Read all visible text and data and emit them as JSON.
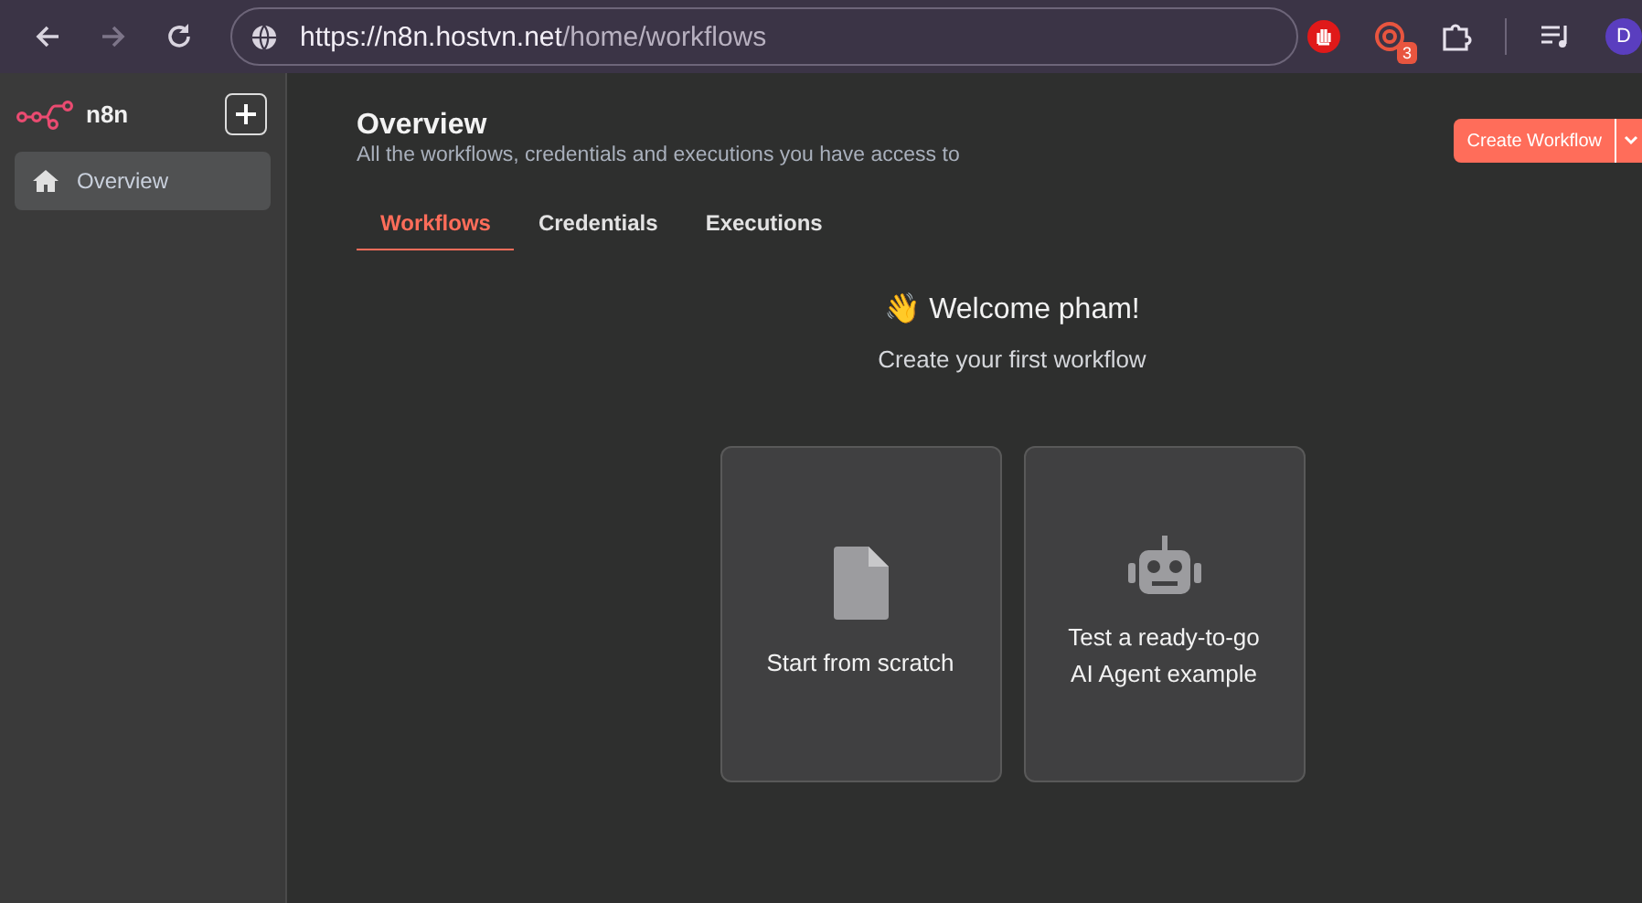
{
  "browser": {
    "url_host": "https://n8n.hostvn.net",
    "url_path": "/home/workflows",
    "extension_badge": "3",
    "avatar": "D"
  },
  "sidebar": {
    "logo": "n8n",
    "items": [
      {
        "label": "Overview",
        "selected": true
      }
    ]
  },
  "header": {
    "title": "Overview",
    "subtitle": "All the workflows, credentials and executions you have access to",
    "create_button": "Create Workflow"
  },
  "tabs": [
    {
      "label": "Workflows",
      "selected": true
    },
    {
      "label": "Credentials",
      "selected": false
    },
    {
      "label": "Executions",
      "selected": false
    }
  ],
  "welcome": {
    "title": "👋 Welcome pham!",
    "subtitle": "Create your first workflow"
  },
  "cards": [
    {
      "kind": "file",
      "lines": [
        "Start from scratch"
      ]
    },
    {
      "kind": "robot",
      "lines": [
        "Test a ready-to-go",
        "AI Agent example"
      ]
    }
  ]
}
